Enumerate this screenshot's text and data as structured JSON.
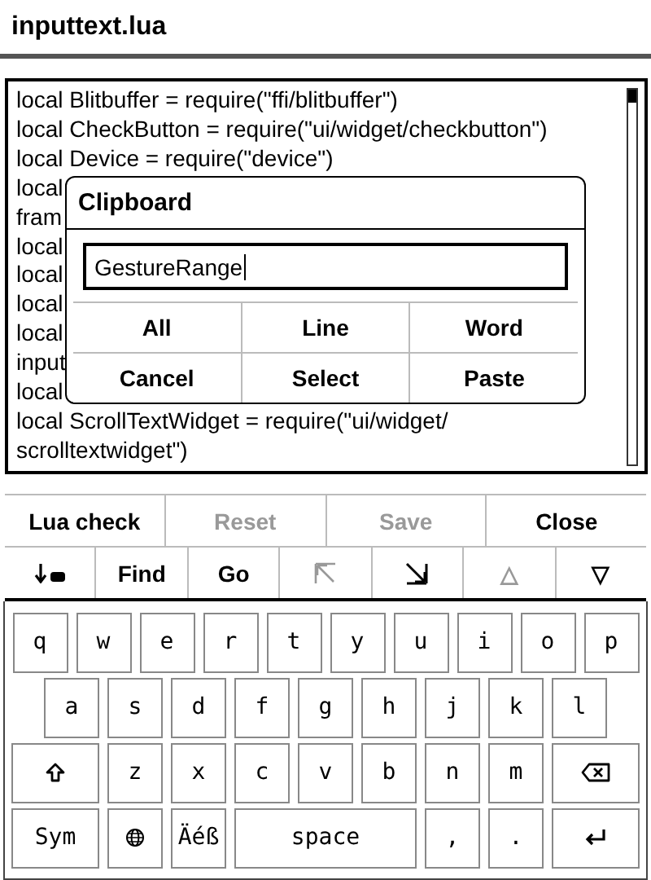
{
  "window": {
    "title": "inputtext.lua"
  },
  "editor": {
    "lines": [
      "local Blitbuffer = require(\"ffi/blitbuffer\")",
      "local CheckButton = require(\"ui/widget/checkbutton\")",
      "local Device = require(\"device\")",
      "local",
      "fram",
      "local",
      "local",
      "local",
      "local",
      "input",
      "local",
      "local ScrollTextWidget = require(\"ui/widget/",
      "scrolltextwidget\")"
    ]
  },
  "dialog": {
    "title": "Clipboard",
    "value": "GestureRange",
    "buttons": [
      [
        "All",
        "Line",
        "Word"
      ],
      [
        "Cancel",
        "Select",
        "Paste"
      ]
    ]
  },
  "actions": [
    {
      "label": "Lua check",
      "disabled": false
    },
    {
      "label": "Reset",
      "disabled": true
    },
    {
      "label": "Save",
      "disabled": true
    },
    {
      "label": "Close",
      "disabled": false
    }
  ],
  "tools": [
    {
      "kind": "icon",
      "disabled": false
    },
    {
      "kind": "text",
      "label": "Find",
      "disabled": false
    },
    {
      "kind": "text",
      "label": "Go",
      "disabled": false
    },
    {
      "kind": "icon",
      "disabled": true
    },
    {
      "kind": "icon",
      "disabled": false
    },
    {
      "kind": "text",
      "label": "△",
      "disabled": true
    },
    {
      "kind": "text",
      "label": "▽",
      "disabled": false
    }
  ],
  "keyboard": {
    "rows": [
      {
        "keys": [
          {
            "kind": "letter",
            "label": "q"
          },
          {
            "kind": "letter",
            "label": "w"
          },
          {
            "kind": "letter",
            "label": "e"
          },
          {
            "kind": "letter",
            "label": "r"
          },
          {
            "kind": "letter",
            "label": "t"
          },
          {
            "kind": "letter",
            "label": "y"
          },
          {
            "kind": "letter",
            "label": "u"
          },
          {
            "kind": "letter",
            "label": "i"
          },
          {
            "kind": "letter",
            "label": "o"
          },
          {
            "kind": "letter",
            "label": "p"
          }
        ]
      },
      {
        "keys": [
          {
            "kind": "letter",
            "label": "a"
          },
          {
            "kind": "letter",
            "label": "s"
          },
          {
            "kind": "letter",
            "label": "d"
          },
          {
            "kind": "letter",
            "label": "f"
          },
          {
            "kind": "letter",
            "label": "g"
          },
          {
            "kind": "letter",
            "label": "h"
          },
          {
            "kind": "letter",
            "label": "j"
          },
          {
            "kind": "letter",
            "label": "k"
          },
          {
            "kind": "letter",
            "label": "l"
          }
        ]
      },
      {
        "keys": [
          {
            "kind": "shift"
          },
          {
            "kind": "letter",
            "label": "z"
          },
          {
            "kind": "letter",
            "label": "x"
          },
          {
            "kind": "letter",
            "label": "c"
          },
          {
            "kind": "letter",
            "label": "v"
          },
          {
            "kind": "letter",
            "label": "b"
          },
          {
            "kind": "letter",
            "label": "n"
          },
          {
            "kind": "letter",
            "label": "m"
          },
          {
            "kind": "backspace"
          }
        ]
      },
      {
        "keys": [
          {
            "kind": "wide",
            "label": "Sym"
          },
          {
            "kind": "globe"
          },
          {
            "kind": "letter",
            "label": "Äéß"
          },
          {
            "kind": "space",
            "label": "space"
          },
          {
            "kind": "letter",
            "label": ","
          },
          {
            "kind": "letter",
            "label": "."
          },
          {
            "kind": "enter"
          }
        ]
      }
    ]
  }
}
